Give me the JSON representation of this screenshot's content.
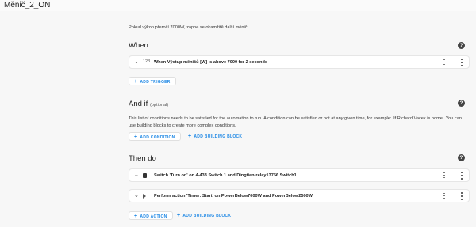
{
  "header": {
    "title": "Měnič_2_ON"
  },
  "description": "Pokud výkon přeročí 7000W, zapne se okamžitě další měnič",
  "sections": {
    "when": {
      "title": "When",
      "items": [
        {
          "icon": "123",
          "text": "When Výstup měničů [W] is above 7000 for 2 seconds"
        }
      ],
      "add_trigger": "ADD TRIGGER"
    },
    "and_if": {
      "title": "And if",
      "optional": "(optional)",
      "help_text": "This list of conditions needs to be satisfied for the automation to run. A condition can be satisfied or not at any given time, for example: 'If Richard Vacek is home'. You can use building blocks to create more complex conditions.",
      "add_condition": "ADD CONDITION",
      "add_building_block": "ADD BUILDING BLOCK"
    },
    "then_do": {
      "title": "Then do",
      "items": [
        {
          "icon": "device-icon",
          "text": "Switch 'Turn on' on 4-433 Switch 1 and Dingtian-relay13756 Switch1"
        },
        {
          "icon": "play-icon",
          "text": "Perform action 'Timer: Start' on PowerBelow7000W and PowerBelow2500W"
        }
      ],
      "add_action": "ADD ACTION",
      "add_building_block": "ADD BUILDING BLOCK"
    }
  },
  "help_icon_glyph": "?",
  "plus_glyph": "+",
  "chevron_glyph": "⌄",
  "colors": {
    "accent": "#1e88e5",
    "background": "#f7f7f7",
    "card": "#ffffff"
  }
}
